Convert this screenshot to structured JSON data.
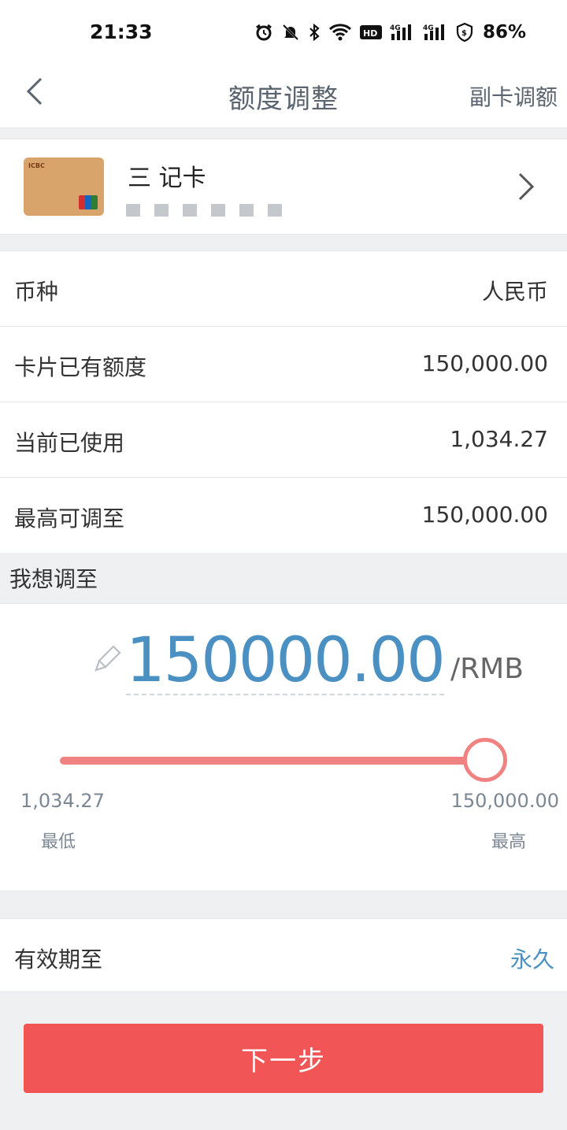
{
  "status_bar": {
    "time": "21:33",
    "battery": "86%",
    "icons": [
      "alarm-icon",
      "mute-bell-icon",
      "bluetooth-icon",
      "wifi-icon",
      "hd-icon",
      "signal-4g-icon",
      "signal-4g-icon",
      "shield-icon"
    ]
  },
  "header": {
    "title": "额度调整",
    "right_action": "副卡调额"
  },
  "card": {
    "name_visible": "三  记卡"
  },
  "info": {
    "rows": [
      {
        "label": "币种",
        "value": "人民币"
      },
      {
        "label": "卡片已有额度",
        "value": "150,000.00"
      },
      {
        "label": "当前已使用",
        "value": "1,034.27"
      },
      {
        "label": "最高可调至",
        "value": "150,000.00"
      }
    ]
  },
  "adjust": {
    "section_title": "我想调至",
    "amount": "150000.00",
    "unit": "/RMB",
    "min_value": "1,034.27",
    "max_value": "150,000.00",
    "min_label": "最低",
    "max_label": "最高",
    "slider_level": 1.0
  },
  "validity": {
    "label": "有效期至",
    "value": "永久"
  },
  "footer": {
    "next_label": "下一步"
  },
  "colors": {
    "accent_blue": "#4a90c2",
    "slider": "#f08282",
    "primary_button": "#f25555"
  }
}
